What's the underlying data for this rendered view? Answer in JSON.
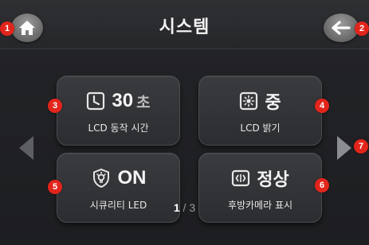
{
  "header": {
    "title": "시스템",
    "home_icon": "home-icon",
    "back_icon": "arrow-left-icon"
  },
  "tiles": [
    {
      "id": 3,
      "icon": "clock-icon",
      "value": "30",
      "unit": "초",
      "label": "LCD 동작 시간"
    },
    {
      "id": 4,
      "icon": "brightness-icon",
      "value": "중",
      "unit": "",
      "label": "LCD 밝기"
    },
    {
      "id": 5,
      "icon": "shield-led-icon",
      "value": "ON",
      "unit": "",
      "label": "시큐리티 LED"
    },
    {
      "id": 6,
      "icon": "camera-display-icon",
      "value": "정상",
      "unit": "",
      "label": "후방카메라 표시"
    }
  ],
  "pager": {
    "current": "1",
    "separator": "/",
    "total": "3"
  },
  "markers": {
    "m1": "1",
    "m2": "2",
    "m3": "3",
    "m4": "4",
    "m5": "5",
    "m6": "6",
    "m7": "7"
  },
  "colors": {
    "marker": "#e2251c",
    "background": "#1d1e21",
    "tile": "#333438"
  }
}
